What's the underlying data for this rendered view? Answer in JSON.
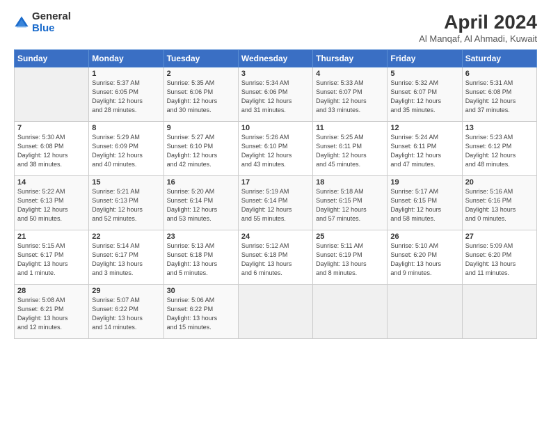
{
  "header": {
    "logo_general": "General",
    "logo_blue": "Blue",
    "title": "April 2024",
    "location": "Al Manqaf, Al Ahmadi, Kuwait"
  },
  "days_of_week": [
    "Sunday",
    "Monday",
    "Tuesday",
    "Wednesday",
    "Thursday",
    "Friday",
    "Saturday"
  ],
  "weeks": [
    [
      {
        "day": "",
        "text": ""
      },
      {
        "day": "1",
        "text": "Sunrise: 5:37 AM\nSunset: 6:05 PM\nDaylight: 12 hours\nand 28 minutes."
      },
      {
        "day": "2",
        "text": "Sunrise: 5:35 AM\nSunset: 6:06 PM\nDaylight: 12 hours\nand 30 minutes."
      },
      {
        "day": "3",
        "text": "Sunrise: 5:34 AM\nSunset: 6:06 PM\nDaylight: 12 hours\nand 31 minutes."
      },
      {
        "day": "4",
        "text": "Sunrise: 5:33 AM\nSunset: 6:07 PM\nDaylight: 12 hours\nand 33 minutes."
      },
      {
        "day": "5",
        "text": "Sunrise: 5:32 AM\nSunset: 6:07 PM\nDaylight: 12 hours\nand 35 minutes."
      },
      {
        "day": "6",
        "text": "Sunrise: 5:31 AM\nSunset: 6:08 PM\nDaylight: 12 hours\nand 37 minutes."
      }
    ],
    [
      {
        "day": "7",
        "text": "Sunrise: 5:30 AM\nSunset: 6:08 PM\nDaylight: 12 hours\nand 38 minutes."
      },
      {
        "day": "8",
        "text": "Sunrise: 5:29 AM\nSunset: 6:09 PM\nDaylight: 12 hours\nand 40 minutes."
      },
      {
        "day": "9",
        "text": "Sunrise: 5:27 AM\nSunset: 6:10 PM\nDaylight: 12 hours\nand 42 minutes."
      },
      {
        "day": "10",
        "text": "Sunrise: 5:26 AM\nSunset: 6:10 PM\nDaylight: 12 hours\nand 43 minutes."
      },
      {
        "day": "11",
        "text": "Sunrise: 5:25 AM\nSunset: 6:11 PM\nDaylight: 12 hours\nand 45 minutes."
      },
      {
        "day": "12",
        "text": "Sunrise: 5:24 AM\nSunset: 6:11 PM\nDaylight: 12 hours\nand 47 minutes."
      },
      {
        "day": "13",
        "text": "Sunrise: 5:23 AM\nSunset: 6:12 PM\nDaylight: 12 hours\nand 48 minutes."
      }
    ],
    [
      {
        "day": "14",
        "text": "Sunrise: 5:22 AM\nSunset: 6:13 PM\nDaylight: 12 hours\nand 50 minutes."
      },
      {
        "day": "15",
        "text": "Sunrise: 5:21 AM\nSunset: 6:13 PM\nDaylight: 12 hours\nand 52 minutes."
      },
      {
        "day": "16",
        "text": "Sunrise: 5:20 AM\nSunset: 6:14 PM\nDaylight: 12 hours\nand 53 minutes."
      },
      {
        "day": "17",
        "text": "Sunrise: 5:19 AM\nSunset: 6:14 PM\nDaylight: 12 hours\nand 55 minutes."
      },
      {
        "day": "18",
        "text": "Sunrise: 5:18 AM\nSunset: 6:15 PM\nDaylight: 12 hours\nand 57 minutes."
      },
      {
        "day": "19",
        "text": "Sunrise: 5:17 AM\nSunset: 6:15 PM\nDaylight: 12 hours\nand 58 minutes."
      },
      {
        "day": "20",
        "text": "Sunrise: 5:16 AM\nSunset: 6:16 PM\nDaylight: 13 hours\nand 0 minutes."
      }
    ],
    [
      {
        "day": "21",
        "text": "Sunrise: 5:15 AM\nSunset: 6:17 PM\nDaylight: 13 hours\nand 1 minute."
      },
      {
        "day": "22",
        "text": "Sunrise: 5:14 AM\nSunset: 6:17 PM\nDaylight: 13 hours\nand 3 minutes."
      },
      {
        "day": "23",
        "text": "Sunrise: 5:13 AM\nSunset: 6:18 PM\nDaylight: 13 hours\nand 5 minutes."
      },
      {
        "day": "24",
        "text": "Sunrise: 5:12 AM\nSunset: 6:18 PM\nDaylight: 13 hours\nand 6 minutes."
      },
      {
        "day": "25",
        "text": "Sunrise: 5:11 AM\nSunset: 6:19 PM\nDaylight: 13 hours\nand 8 minutes."
      },
      {
        "day": "26",
        "text": "Sunrise: 5:10 AM\nSunset: 6:20 PM\nDaylight: 13 hours\nand 9 minutes."
      },
      {
        "day": "27",
        "text": "Sunrise: 5:09 AM\nSunset: 6:20 PM\nDaylight: 13 hours\nand 11 minutes."
      }
    ],
    [
      {
        "day": "28",
        "text": "Sunrise: 5:08 AM\nSunset: 6:21 PM\nDaylight: 13 hours\nand 12 minutes."
      },
      {
        "day": "29",
        "text": "Sunrise: 5:07 AM\nSunset: 6:22 PM\nDaylight: 13 hours\nand 14 minutes."
      },
      {
        "day": "30",
        "text": "Sunrise: 5:06 AM\nSunset: 6:22 PM\nDaylight: 13 hours\nand 15 minutes."
      },
      {
        "day": "",
        "text": ""
      },
      {
        "day": "",
        "text": ""
      },
      {
        "day": "",
        "text": ""
      },
      {
        "day": "",
        "text": ""
      }
    ]
  ]
}
